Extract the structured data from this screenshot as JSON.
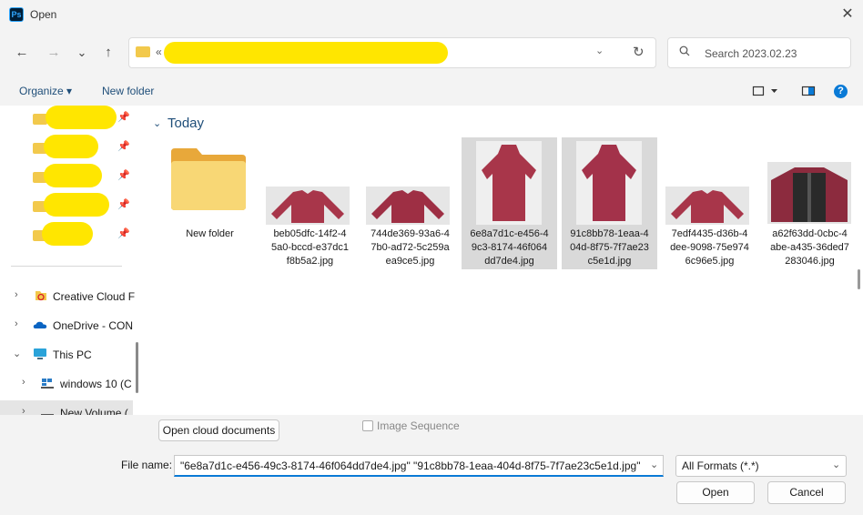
{
  "window": {
    "title": "Open",
    "app_icon": "Ps"
  },
  "nav": {
    "back_icon": "←",
    "forward_icon": "→",
    "recent_icon": "⌄",
    "up_icon": "↑"
  },
  "address": {
    "prefix": "«",
    "dropdown_icon": "⌄",
    "refresh_icon": "↻"
  },
  "search": {
    "placeholder": "Search 2023.02.23"
  },
  "toolbar": {
    "organize_label": "Organize ▾",
    "new_folder_label": "New folder",
    "help_label": "?"
  },
  "sidebar": {
    "pin_icon": "📌",
    "tree": [
      {
        "label": "Creative Cloud F",
        "icon": "creative-cloud-icon"
      },
      {
        "label": "OneDrive - CON",
        "icon": "onedrive-icon"
      },
      {
        "label": "This PC",
        "icon": "this-pc-icon"
      },
      {
        "label": "windows 10  (C",
        "icon": "drive-icon"
      },
      {
        "label": "New Volume (",
        "icon": "drive-icon"
      }
    ]
  },
  "content": {
    "group": "Today",
    "items": [
      {
        "name": "New folder",
        "type": "folder",
        "selected": false
      },
      {
        "name": "beb05dfc-14f2-4\n5a0-bccd-e37dc1\nf8b5a2.jpg",
        "type": "image",
        "selected": false
      },
      {
        "name": "744de369-93a6-4\n7b0-ad72-5c259a\nea9ce5.jpg",
        "type": "image",
        "selected": false
      },
      {
        "name": "6e8a7d1c-e456-4\n9c3-8174-46f064\ndd7de4.jpg",
        "type": "image",
        "selected": true
      },
      {
        "name": "91c8bb78-1eaa-4\n04d-8f75-7f7ae23\nc5e1d.jpg",
        "type": "image",
        "selected": true
      },
      {
        "name": "7edf4435-d36b-4\ndee-9098-75e974\n6c96e5.jpg",
        "type": "image",
        "selected": false
      },
      {
        "name": "a62f63dd-0cbc-4\nabe-a435-36ded7\n283046.jpg",
        "type": "image",
        "selected": false
      }
    ]
  },
  "footer": {
    "cloud_button": "Open cloud documents",
    "image_sequence_label": "Image Sequence",
    "file_name_label": "File name:",
    "file_name_value": "\"6e8a7d1c-e456-49c3-8174-46f064dd7de4.jpg\" \"91c8bb78-1eaa-404d-8f75-7f7ae23c5e1d.jpg\"",
    "format_value": "All Formats (*.*)",
    "open_label": "Open",
    "cancel_label": "Cancel"
  },
  "colors": {
    "accent": "#0a7ad6",
    "redaction": "#ffe600",
    "folder": "#f2c94c",
    "jacket": "#a8364a"
  }
}
